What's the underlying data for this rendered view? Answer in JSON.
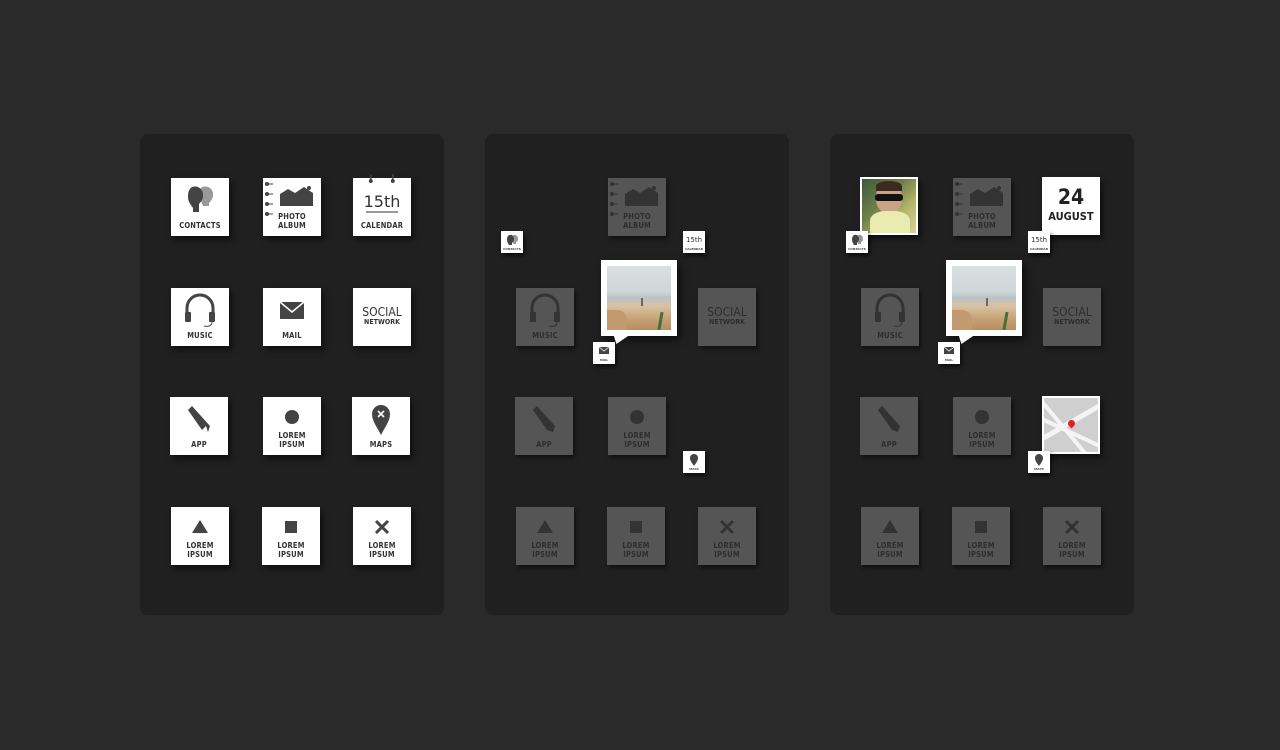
{
  "screens": [
    {
      "name": "home-grid",
      "tiles": {
        "contacts": "CONTACTS",
        "photo_album": [
          "PHOTO",
          "ALBUM"
        ],
        "calendar_day": "15th",
        "calendar": "CALENDAR",
        "music": "MUSIC",
        "mail": "MAIL",
        "social": [
          "SOCIAL",
          "NETWORK"
        ],
        "app": "APP",
        "lorem1": [
          "LOREM",
          "IPSUM"
        ],
        "maps": "MAPS",
        "lorem2": [
          "LOREM",
          "IPSUM"
        ],
        "lorem3": [
          "LOREM",
          "IPSUM"
        ],
        "lorem4": [
          "LOREM",
          "IPSUM"
        ]
      }
    },
    {
      "name": "transition",
      "mini_labels": {
        "contacts": "CONTACTS",
        "calendar": "15th",
        "calendar_caption": "CALENDAR",
        "mail": "MAIL",
        "maps": "MAPS"
      }
    },
    {
      "name": "live-tiles",
      "date": {
        "day": "24",
        "month": "AUGUST"
      }
    }
  ],
  "colors": {
    "background": "#2a2a2a",
    "panel": "#202020",
    "tile": "#ffffff",
    "tile_dim": "#555555"
  }
}
